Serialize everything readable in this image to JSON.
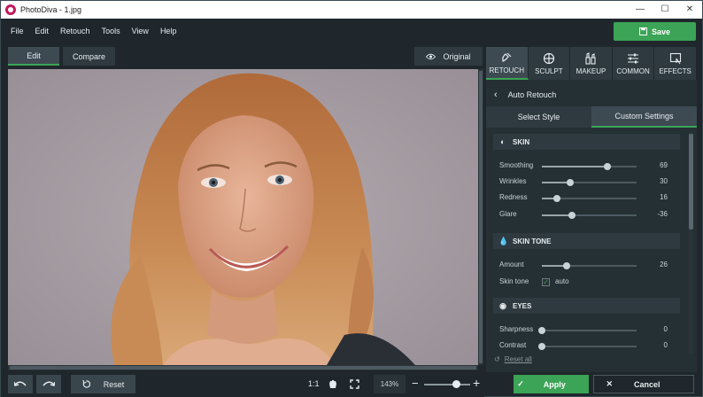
{
  "window": {
    "title": "PhotoDiva - 1.jpg",
    "minimize": "—",
    "maximize": "☐",
    "close": "✕"
  },
  "menu": [
    "File",
    "Edit",
    "Retouch",
    "Tools",
    "View",
    "Help"
  ],
  "save_label": "Save",
  "view_tabs": {
    "edit": "Edit",
    "compare": "Compare",
    "original": "Original"
  },
  "right_tabs": [
    {
      "label": "RETOUCH",
      "icon": "retouch-icon"
    },
    {
      "label": "SCULPT",
      "icon": "sculpt-icon"
    },
    {
      "label": "MAKEUP",
      "icon": "makeup-icon"
    },
    {
      "label": "COMMON",
      "icon": "sliders-icon"
    },
    {
      "label": "EFFECTS",
      "icon": "effects-icon"
    }
  ],
  "panel": {
    "back_title": "Auto Retouch",
    "subtabs": {
      "select_style": "Select Style",
      "custom_settings": "Custom Settings"
    },
    "skin": {
      "title": "SKIN",
      "rows": [
        {
          "label": "Smoothing",
          "value": "69",
          "level": 0.69
        },
        {
          "label": "Wrinkles",
          "value": "30",
          "level": 0.3
        },
        {
          "label": "Redness",
          "value": "16",
          "level": 0.16
        },
        {
          "label": "Glare",
          "value": "-36",
          "level": 0.32
        }
      ]
    },
    "skin_tone": {
      "title": "SKIN TONE",
      "amount_label": "Amount",
      "amount_value": "26",
      "amount_level": 0.26,
      "tone_label": "Skin tone",
      "auto_label": "auto"
    },
    "eyes": {
      "title": "EYES",
      "rows": [
        {
          "label": "Sharpness",
          "value": "0",
          "level": 0.0
        },
        {
          "label": "Contrast",
          "value": "0",
          "level": 0.0
        }
      ]
    },
    "reset_all": "Reset all"
  },
  "bottom": {
    "reset_label": "Reset",
    "one_to_one": "1:1",
    "zoom": "143%",
    "zoom_level": 0.62
  },
  "actions": {
    "apply": "Apply",
    "cancel": "Cancel"
  },
  "colors": {
    "accent": "#3ba456",
    "background": "#1f272c",
    "panel": "#253035"
  }
}
